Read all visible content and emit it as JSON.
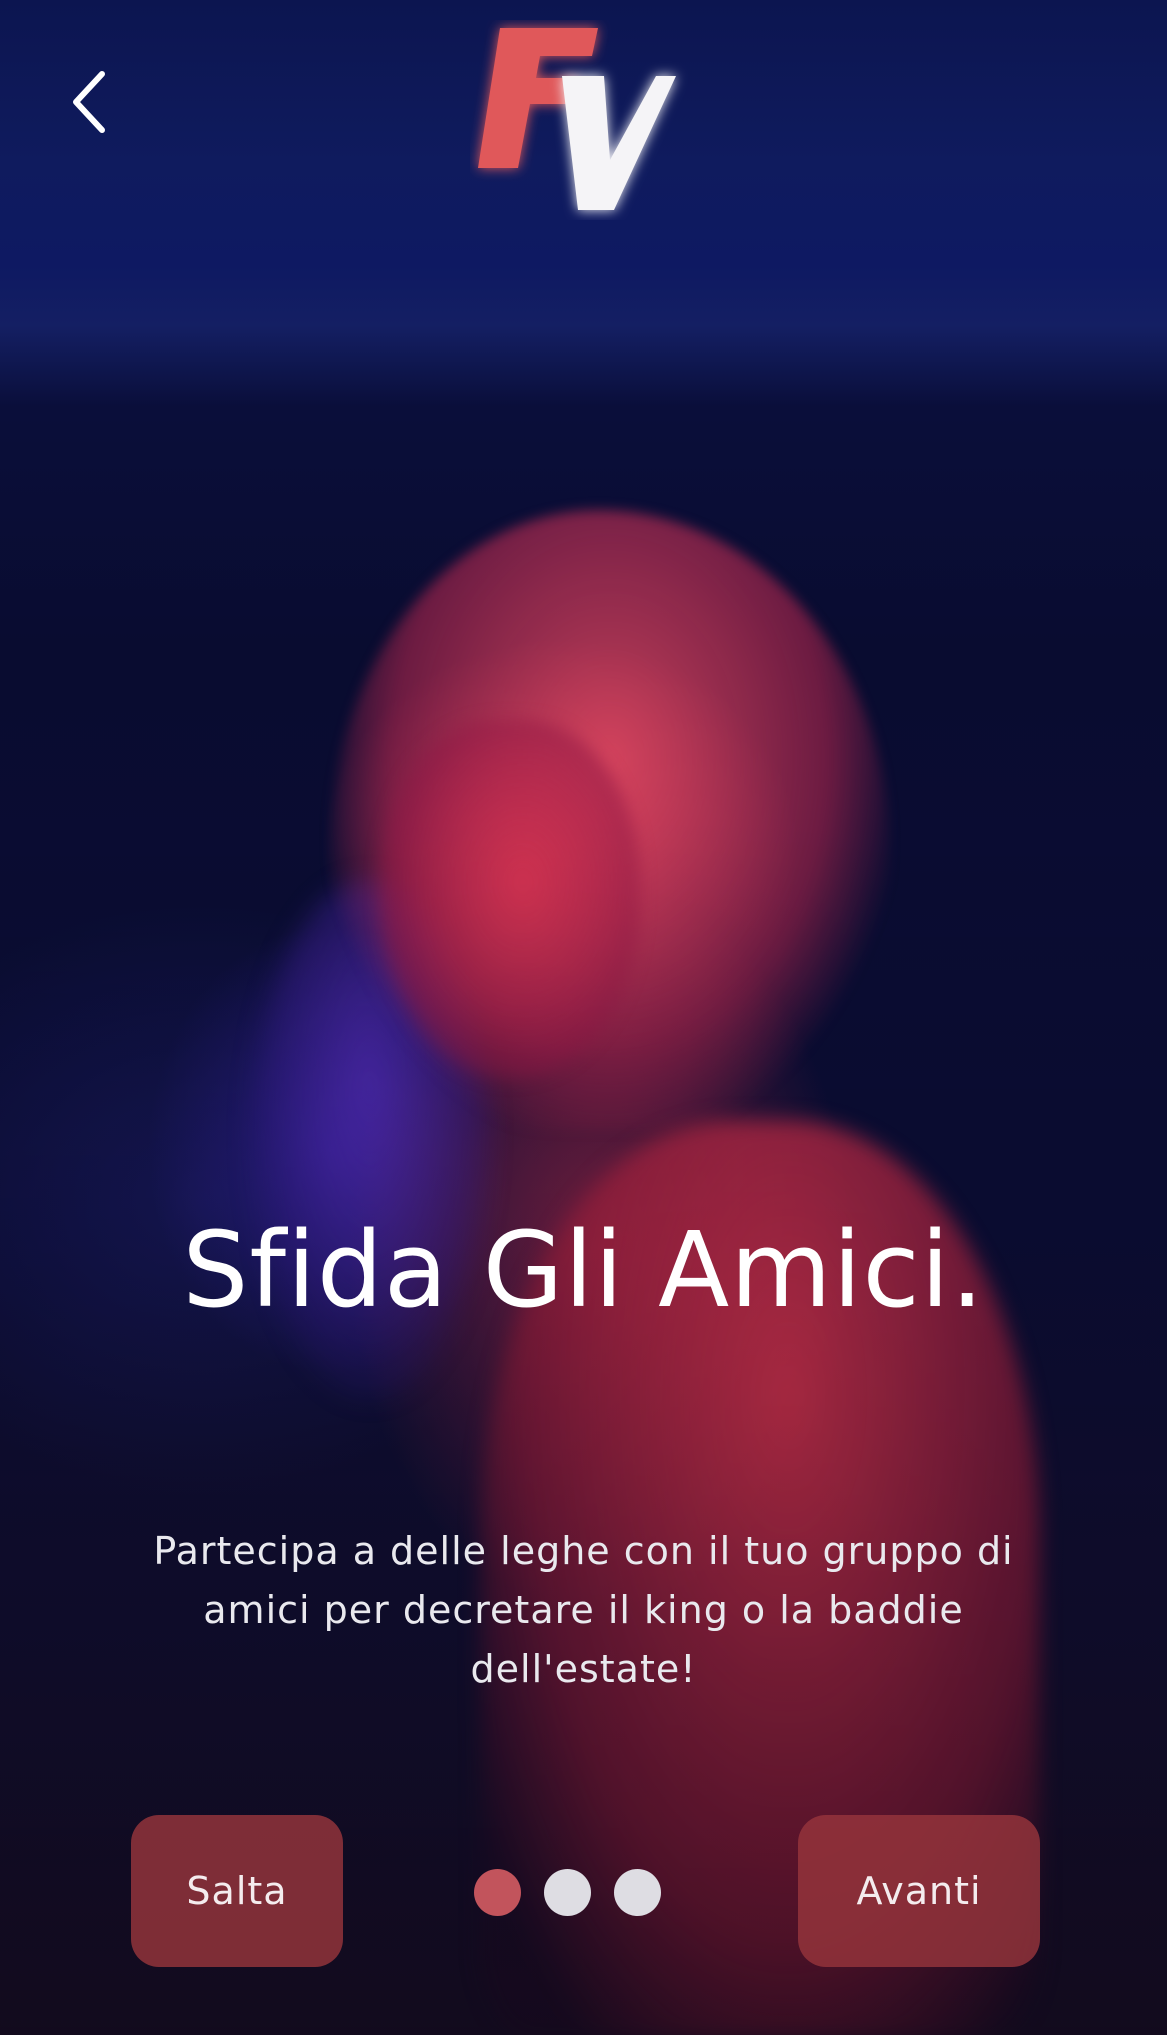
{
  "header": {
    "back_icon": "chevron-left-icon",
    "logo": {
      "text": "FV",
      "colors": {
        "letter_f": "#e0585a",
        "letter_v": "#f5f4f7"
      }
    }
  },
  "onboarding": {
    "title": "Sfida Gli Amici.",
    "description": "Partecipa a delle leghe con il tuo gruppo di amici per decretare il king o la baddie dell'estate!"
  },
  "pagination": {
    "pages": 3,
    "current": 1,
    "colors": {
      "active": "#c2545c",
      "inactive": "#dedde3"
    }
  },
  "actions": {
    "skip_label": "Salta",
    "next_label": "Avanti",
    "button_color": "#96343c"
  }
}
